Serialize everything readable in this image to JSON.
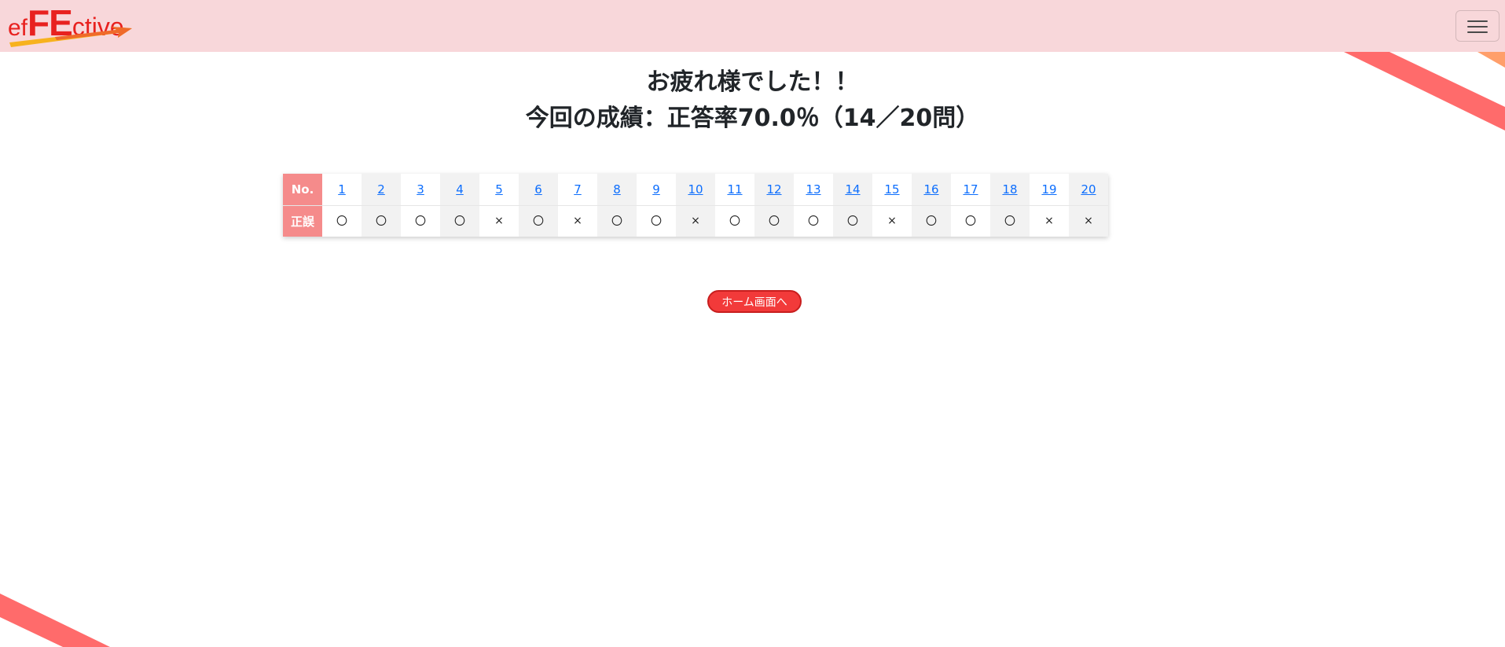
{
  "header": {
    "logo": {
      "part1": "ef",
      "part2": "FE",
      "part3": "ctive"
    },
    "menu_icon": "hamburger-menu-icon"
  },
  "heading": {
    "line1": "お疲れ様でした！！",
    "line2": "今回の成績：正答率70.0％（14／20問）"
  },
  "results": {
    "no_label": "No.",
    "result_label": "正誤",
    "numbers": [
      "1",
      "2",
      "3",
      "4",
      "5",
      "6",
      "7",
      "8",
      "9",
      "10",
      "11",
      "12",
      "13",
      "14",
      "15",
      "16",
      "17",
      "18",
      "19",
      "20"
    ],
    "marks": [
      "〇",
      "〇",
      "〇",
      "〇",
      "×",
      "〇",
      "×",
      "〇",
      "〇",
      "×",
      "〇",
      "〇",
      "〇",
      "〇",
      "×",
      "〇",
      "〇",
      "〇",
      "×",
      "×"
    ]
  },
  "home_button": {
    "label": "ホーム画面へ"
  },
  "colors": {
    "navbar": "#f8d7da",
    "logo": "#e8211f",
    "table_header": "#f58b8b",
    "button": "#f23a3a",
    "stripe": "#ff6b6b",
    "link": "#0d6efd"
  }
}
